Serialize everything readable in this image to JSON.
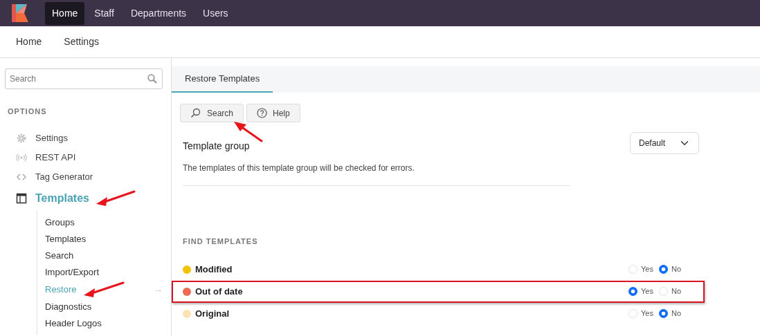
{
  "top_nav": {
    "items": [
      {
        "label": "Home",
        "selected": true
      },
      {
        "label": "Staff",
        "selected": false
      },
      {
        "label": "Departments",
        "selected": false
      },
      {
        "label": "Users",
        "selected": false
      }
    ]
  },
  "sub_nav": {
    "items": [
      {
        "label": "Home"
      },
      {
        "label": "Settings"
      }
    ]
  },
  "sidebar": {
    "search": {
      "placeholder": "Search"
    },
    "section_title": "OPTIONS",
    "items": [
      {
        "label": "Settings",
        "selected": false,
        "arrow": false
      },
      {
        "label": "REST API",
        "selected": false,
        "arrow": false
      },
      {
        "label": "Tag Generator",
        "selected": false,
        "arrow": false
      },
      {
        "label": "Templates",
        "selected": true,
        "arrow": true,
        "children": [
          {
            "label": "Groups",
            "selected": false,
            "arrow": false
          },
          {
            "label": "Templates",
            "selected": false,
            "arrow": false
          },
          {
            "label": "Search",
            "selected": false,
            "arrow": false
          },
          {
            "label": "Import/Export",
            "selected": false,
            "arrow": false
          },
          {
            "label": "Restore",
            "selected": true,
            "arrow": true,
            "indicator": "→"
          },
          {
            "label": "Diagnostics",
            "selected": false,
            "arrow": false
          },
          {
            "label": "Header Logos",
            "selected": false,
            "arrow": false
          }
        ]
      }
    ]
  },
  "panel": {
    "tabs": [
      {
        "label": "Restore Templates",
        "selected": true
      }
    ],
    "toolbar": [
      {
        "label": "Search",
        "arrow": true
      },
      {
        "label": "Help",
        "arrow": false
      }
    ],
    "field": {
      "label": "Template group",
      "description": "The templates of this template group will be checked for errors.",
      "value": "Default"
    },
    "section_title": "FIND TEMPLATES",
    "filters": [
      {
        "label": "Modified",
        "color": "#f2c200",
        "highlighted": false,
        "options": [
          {
            "label": "Yes",
            "selected": false
          },
          {
            "label": "No",
            "selected": true
          }
        ]
      },
      {
        "label": "Out of date",
        "color": "#ee6a50",
        "highlighted": true,
        "options": [
          {
            "label": "Yes",
            "selected": true
          },
          {
            "label": "No",
            "selected": false
          }
        ]
      },
      {
        "label": "Original",
        "color": "#fde3b4",
        "highlighted": false,
        "options": [
          {
            "label": "Yes",
            "selected": false
          },
          {
            "label": "No",
            "selected": true
          }
        ]
      }
    ]
  }
}
